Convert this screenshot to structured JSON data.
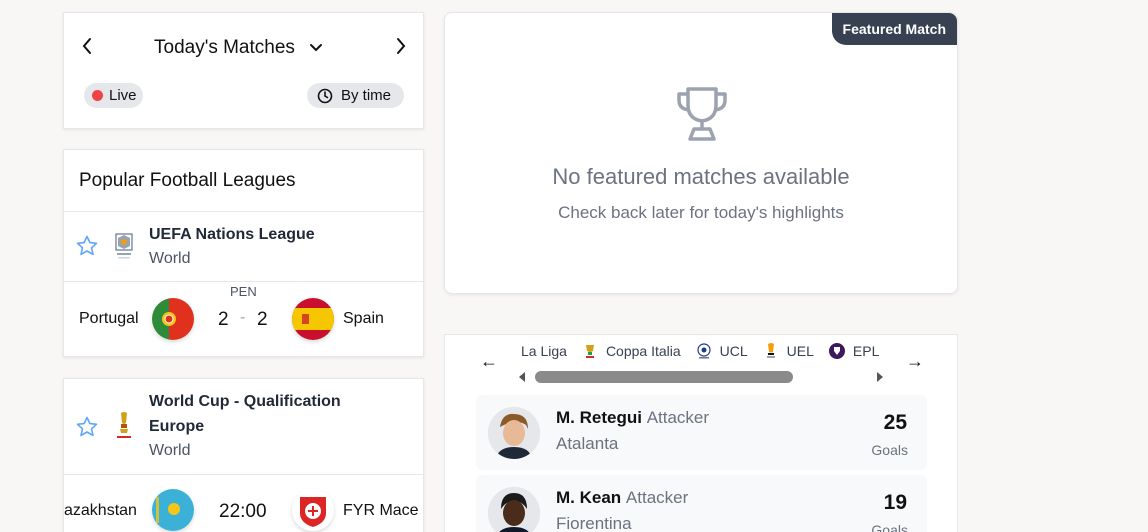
{
  "today": {
    "title": "Today's Matches",
    "live_label": "Live",
    "by_time_label": "By time"
  },
  "leagues": {
    "header": "Popular Football Leagues",
    "items": [
      {
        "name": "UEFA Nations League",
        "region": "World",
        "match": {
          "home": "Portugal",
          "away": "Spain",
          "status": "PEN",
          "home_score": "2",
          "away_score": "2",
          "sep": "-"
        }
      }
    ]
  },
  "worldcup": {
    "name_line1": "World Cup - Qualification",
    "name_line2": "Europe",
    "region": "World",
    "match": {
      "home": "azakhstan",
      "away": "FYR Mace",
      "time": "22:00"
    }
  },
  "featured": {
    "badge": "Featured Match",
    "empty_title": "No featured matches available",
    "empty_subtitle": "Check back later for today's highlights"
  },
  "scorers": {
    "prev_arrow": "←",
    "next_arrow": "→",
    "tabs": [
      "La Liga",
      "Coppa Italia",
      "UCL",
      "UEL",
      "EPL"
    ],
    "players": [
      {
        "name": "M. Retegui",
        "position": "Attacker",
        "team": "Atalanta",
        "goals": "25",
        "goals_label": "Goals"
      },
      {
        "name": "M. Kean",
        "position": "Attacker",
        "team": "Fiorentina",
        "goals": "19",
        "goals_label": "Goals"
      }
    ]
  },
  "colors": {
    "live_dot": "#ef4444",
    "badge_bg": "#374151",
    "pill_bg": "#e5e7eb"
  }
}
